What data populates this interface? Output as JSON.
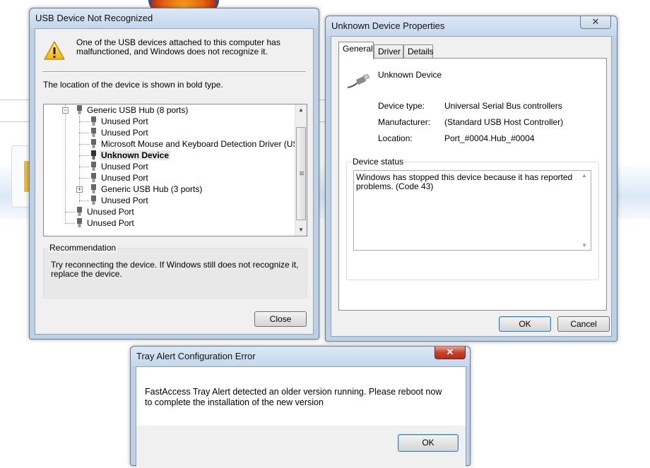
{
  "background": {
    "browser_logo_icon": "firefox-logo"
  },
  "usb_dialog": {
    "title": "USB Device Not Recognized",
    "message": "One of the USB devices attached to this computer has malfunctioned, and Windows does not recognize it.",
    "location_note": "The location of the device is shown in bold type.",
    "tree": [
      {
        "label": "Generic USB Hub (8 ports)",
        "level": 1,
        "expander": "−",
        "bold": false
      },
      {
        "label": "Unused Port",
        "level": 2,
        "bold": false
      },
      {
        "label": "Unused Port",
        "level": 2,
        "bold": false
      },
      {
        "label": "Microsoft Mouse and Keyboard Detection Driver (USB)",
        "level": 2,
        "bold": false
      },
      {
        "label": "Unknown Device",
        "level": 2,
        "bold": true
      },
      {
        "label": "Unused Port",
        "level": 2,
        "bold": false
      },
      {
        "label": "Unused Port",
        "level": 2,
        "bold": false
      },
      {
        "label": "Generic USB Hub (3 ports)",
        "level": 2,
        "expander": "+",
        "bold": false
      },
      {
        "label": "Unused Port",
        "level": 2,
        "bold": false
      },
      {
        "label": "Unused Port",
        "level": 1,
        "bold": false
      },
      {
        "label": "Unused Port",
        "level": 1,
        "bold": false
      }
    ],
    "recommendation_label": "Recommendation",
    "recommendation_text": "Try reconnecting the device. If Windows still does not recognize it, replace the device.",
    "close_button": "Close"
  },
  "props_dialog": {
    "title": "Unknown Device Properties",
    "close_glyph": "✕",
    "tabs": [
      "General",
      "Driver",
      "Details"
    ],
    "active_tab": "General",
    "device_name": "Unknown Device",
    "properties": [
      {
        "label": "Device type:",
        "value": "Universal Serial Bus controllers"
      },
      {
        "label": "Manufacturer:",
        "value": "(Standard USB Host Controller)"
      },
      {
        "label": "Location:",
        "value": "Port_#0004.Hub_#0004"
      }
    ],
    "status_label": "Device status",
    "status_text": "Windows has stopped this device because it has reported problems. (Code 43)",
    "ok_button": "OK",
    "cancel_button": "Cancel"
  },
  "tray_dialog": {
    "title": "Tray Alert Configuration Error",
    "close_glyph": "✕",
    "message": "FastAccess Tray Alert detected an older version running.  Please reboot now to complete the installation of the new version",
    "ok_button": "OK"
  },
  "colors": {
    "title_bar": "#c5d7ec",
    "close_red": "#c7422b",
    "dialog_face": "#f0f0f0"
  }
}
